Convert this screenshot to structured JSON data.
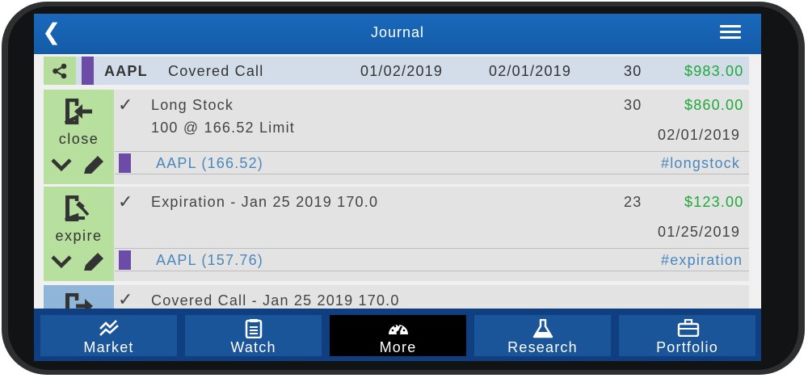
{
  "header": {
    "title": "Journal",
    "back_icon": "back-icon",
    "menu_icon": "hamburger-menu-icon"
  },
  "summary": {
    "symbol": "AAPL",
    "strategy": "Covered Call",
    "open_date": "01/02/2019",
    "close_date": "02/01/2019",
    "days": "30",
    "pnl": "$983.00",
    "icon": "share-icon"
  },
  "entries": [
    {
      "action": "close",
      "icon": "exit-door-icon",
      "title": "Long Stock",
      "detail": "100 @ 166.52 Limit",
      "days": "30",
      "pnl": "$860.00",
      "date": "02/01/2019",
      "ticker": "AAPL (166.52)",
      "tag": "#longstock"
    },
    {
      "action": "expire",
      "icon": "expire-gavel-icon",
      "title": "Expiration - Jan 25 2019 170.0",
      "detail": "",
      "days": "23",
      "pnl": "$123.00",
      "date": "01/25/2019",
      "ticker": "AAPL (157.76)",
      "tag": "#expiration"
    },
    {
      "title": "Covered Call - Jan 25 2019 170.0"
    }
  ],
  "tabs": [
    {
      "label": "Market",
      "icon": "market-chart-icon"
    },
    {
      "label": "Watch",
      "icon": "clipboard-icon"
    },
    {
      "label": "More",
      "icon": "gauge-icon"
    },
    {
      "label": "Research",
      "icon": "flask-icon"
    },
    {
      "label": "Portfolio",
      "icon": "briefcase-icon"
    }
  ],
  "active_tab": "More",
  "colors": {
    "header": "#1a68bb",
    "gain": "#1fa83a",
    "accent_purple": "#6d4ca7",
    "action_green": "#b7df9e",
    "link_blue": "#4a87bd"
  }
}
